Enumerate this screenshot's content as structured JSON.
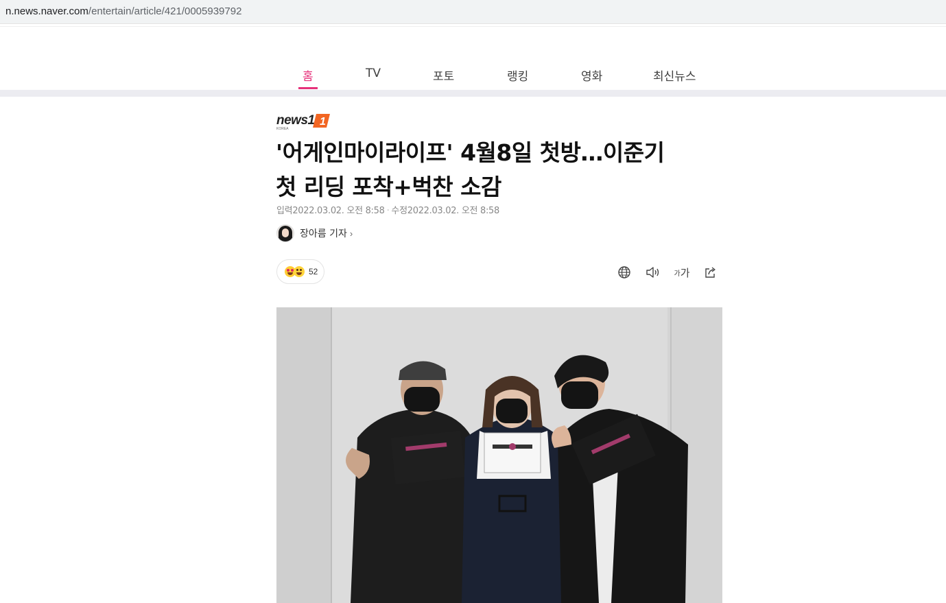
{
  "browser": {
    "url_host": "n.news.naver.com",
    "url_path": "/entertain/article/421/0005939792"
  },
  "nav": {
    "tabs": [
      {
        "label": "홈",
        "active": true
      },
      {
        "label": "TV",
        "active": false
      },
      {
        "label": "포토",
        "active": false
      },
      {
        "label": "랭킹",
        "active": false
      },
      {
        "label": "영화",
        "active": false
      },
      {
        "label": "최신뉴스",
        "active": false
      }
    ],
    "accent_color": "#e6317a"
  },
  "article": {
    "press_logo": "news1",
    "press_logo_sub": "KOREA",
    "title_line1": "'어게인마이라이프' 4월8일 첫방…이준기",
    "title_line2": "첫 리딩 포착+벅찬 소감",
    "input_label": "입력",
    "input_date": "2022.03.02. 오전 8:58",
    "edit_label": "수정",
    "edit_date": "2022.03.02. 오전 8:58",
    "reporter": "장아름 기자",
    "reaction_count": "52",
    "font_size_label_small": "가",
    "font_size_label_large": "가"
  },
  "icons": {
    "globe": "globe-icon",
    "speaker": "speaker-icon",
    "share": "share-icon",
    "chevron": "chevron-right-icon"
  }
}
